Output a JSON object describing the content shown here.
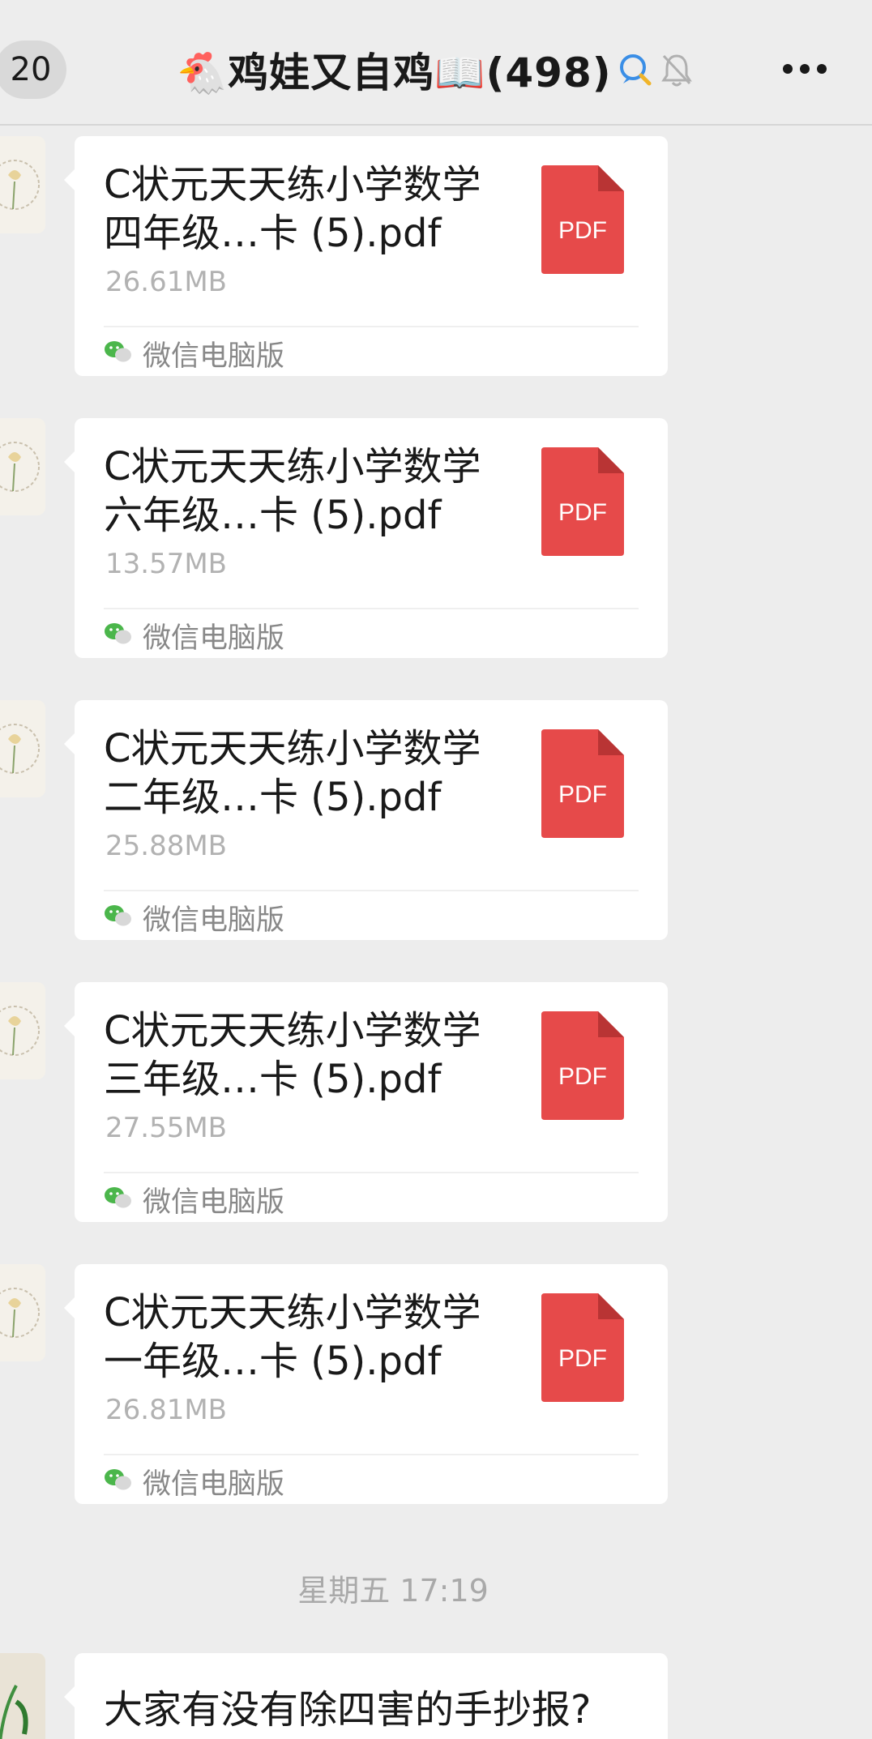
{
  "header": {
    "unread_count": "20",
    "title": "🐔鸡娃又自鸡📖(498)",
    "more_icon": "more-dots-icon",
    "mute_icon": "bell-muted-icon",
    "search_icon": "chat-search-icon"
  },
  "messages": [
    {
      "file_name": "C状元天天练小学数学四年级…卡 (5).pdf",
      "size": "26.61MB",
      "type_label": "PDF",
      "source": "微信电脑版"
    },
    {
      "file_name": "C状元天天练小学数学六年级…卡 (5).pdf",
      "size": "13.57MB",
      "type_label": "PDF",
      "source": "微信电脑版"
    },
    {
      "file_name": "C状元天天练小学数学二年级…卡 (5).pdf",
      "size": "25.88MB",
      "type_label": "PDF",
      "source": "微信电脑版"
    },
    {
      "file_name": "C状元天天练小学数学三年级…卡 (5).pdf",
      "size": "27.55MB",
      "type_label": "PDF",
      "source": "微信电脑版"
    },
    {
      "file_name": "C状元天天练小学数学一年级…卡 (5).pdf",
      "size": "26.81MB",
      "type_label": "PDF",
      "source": "微信电脑版"
    }
  ],
  "timestamp": "星期五 17:19",
  "last_message": {
    "text": "大家有没有除四害的手抄报?"
  },
  "colors": {
    "pdf_red": "#e64a4a",
    "wechat_green": "#4bb64b",
    "background": "#ededed"
  }
}
